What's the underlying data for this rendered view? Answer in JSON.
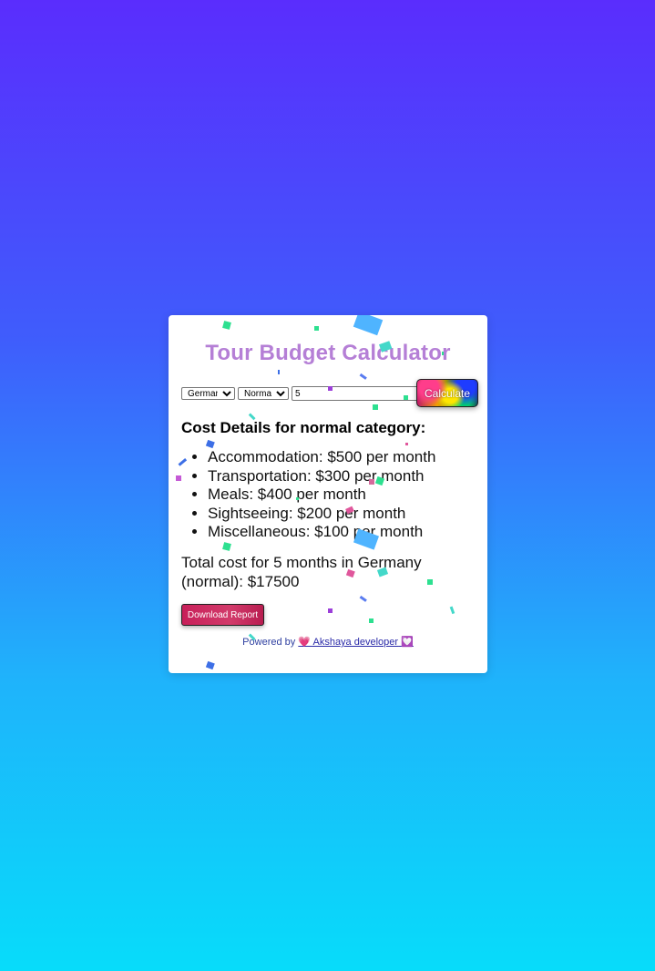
{
  "app": {
    "title": "Tour Budget Calculator"
  },
  "controls": {
    "country_selected": "Germany",
    "category_selected": "Normal",
    "months_value": "5",
    "calculate_label": "Calculate"
  },
  "details": {
    "heading": "Cost Details for normal category:",
    "items": [
      "Accommodation: $500 per month",
      "Transportation: $300 per month",
      "Meals: $400 per month",
      "Sightseeing: $200 per month",
      "Miscellaneous: $100 per month"
    ],
    "total": "Total cost for 5 months in Germany (normal): $17500"
  },
  "actions": {
    "download_label": "Download Report"
  },
  "footer": {
    "powered_by": "Powered by",
    "heart_left": "💗",
    "link_text": "Akshaya developer",
    "heart_right": "💟"
  },
  "colors": {
    "title": "#b57fd6",
    "background_top": "#5a2dfd",
    "background_bottom": "#07dcfa",
    "download_button": "#c8205a"
  }
}
